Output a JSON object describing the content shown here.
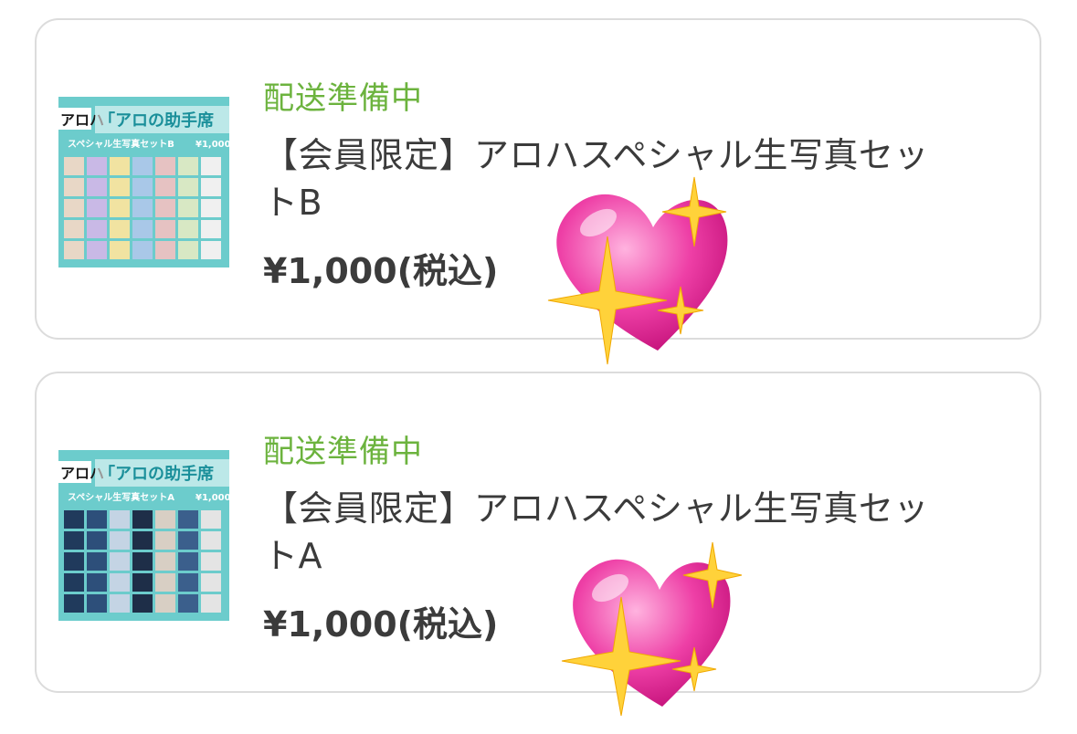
{
  "orders": [
    {
      "status": "配送準備中",
      "title": "【会員限定】アロハスペシャル生写真セットB",
      "price": "¥1,000(税込)",
      "thumbnail": {
        "brand": "アロハ",
        "headline": "「アロの助手席",
        "subtitle": "スペシャル生写真セットB",
        "price": "¥1,000"
      },
      "emoji": "sparkling-heart"
    },
    {
      "status": "配送準備中",
      "title": "【会員限定】アロハスペシャル生写真セットA",
      "price": "¥1,000(税込)",
      "thumbnail": {
        "brand": "アロハ",
        "headline": "「アロの助手席",
        "subtitle": "スペシャル生写真セットA",
        "price": "¥1,000"
      },
      "emoji": "sparkling-heart"
    }
  ],
  "colors": {
    "status": "#6cb33e",
    "text": "#3b3b3b",
    "border": "#dcdcdc",
    "heart": "#ee3fa6",
    "sparkle": "#ffd23a",
    "thumb_bg": "#66c9c9"
  }
}
